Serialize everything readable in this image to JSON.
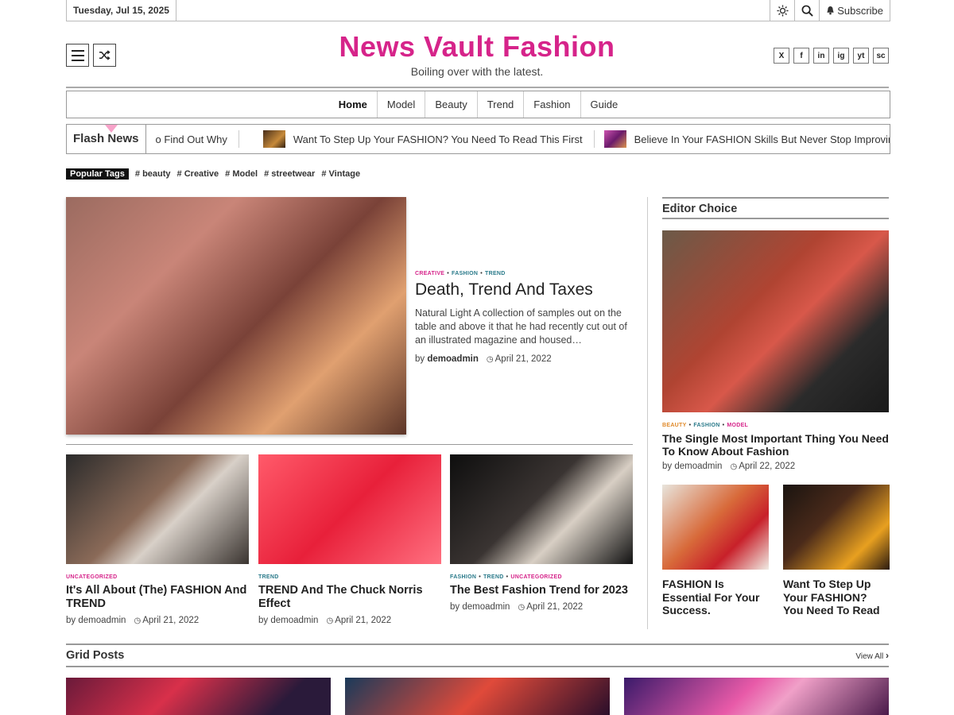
{
  "topbar": {
    "date": "Tuesday, Jul 15, 2025",
    "subscribe": "Subscribe"
  },
  "header": {
    "title": "News Vault Fashion",
    "tagline": "Boiling over with the latest."
  },
  "social": [
    "X",
    "f",
    "in",
    "ig",
    "yt",
    "sc"
  ],
  "nav": [
    "Home",
    "Model",
    "Beauty",
    "Trend",
    "Fashion",
    "Guide"
  ],
  "flash": {
    "label": "Flash News",
    "items": [
      "o Find Out Why",
      "Want To Step Up Your FASHION? You Need To Read This First",
      "Believe In Your FASHION Skills But Never Stop Improving"
    ]
  },
  "tags": {
    "label": "Popular Tags",
    "items": [
      "beauty",
      "Creative",
      "Model",
      "streetwear",
      "Vintage"
    ]
  },
  "featured": {
    "cats": [
      "CREATIVE",
      "FASHION",
      "TREND"
    ],
    "title": "Death, Trend And Taxes",
    "desc": "Natural Light A collection of samples out on the table and above it that he had recently cut out of an illustrated magazine and housed…",
    "by": "by",
    "author": "demoadmin",
    "date": "April 21, 2022"
  },
  "cards": [
    {
      "cats": [
        "UNCATEGORIZED"
      ],
      "title": "It's All About (The) FASHION And TREND",
      "author": "demoadmin",
      "date": "April 21, 2022"
    },
    {
      "cats": [
        "TREND"
      ],
      "title": "TREND And The Chuck Norris Effect",
      "author": "demoadmin",
      "date": "April 21, 2022"
    },
    {
      "cats": [
        "FASHION",
        "TREND",
        "UNCATEGORIZED"
      ],
      "title": "The Best Fashion Trend for 2023",
      "author": "demoadmin",
      "date": "April 21, 2022"
    }
  ],
  "sidebar": {
    "heading": "Editor Choice",
    "main": {
      "cats": [
        "BEAUTY",
        "FASHION",
        "MODEL"
      ],
      "title": "The Single Most Important Thing You Need To Know About Fashion",
      "author": "demoadmin",
      "date": "April 22, 2022"
    },
    "minis": [
      {
        "title": "FASHION Is Essential For Your Success."
      },
      {
        "title": "Want To Step Up Your FASHION? You Need To Read"
      }
    ]
  },
  "grid": {
    "heading": "Grid Posts",
    "view_all": "View All"
  },
  "colors": {
    "brand": "#d6248a",
    "trend": "#2a7a8a",
    "beauty": "#e08a2a"
  }
}
